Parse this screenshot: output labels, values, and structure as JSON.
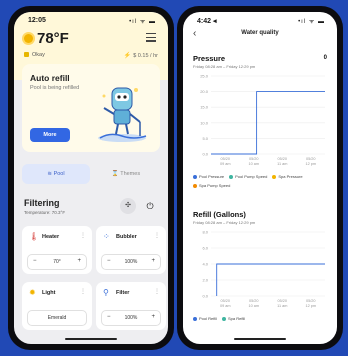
{
  "left_phone": {
    "status": {
      "time": "12:05",
      "signal": "•ıl ᯤ ▬"
    },
    "temperature": "78°F",
    "status_text": "Okay",
    "price": "$ 0.15 / hr",
    "auto_refill": {
      "title": "Auto refill",
      "text": "Pool is being refilled",
      "button": "More"
    },
    "tabs": [
      {
        "label": "Pool"
      },
      {
        "label": "Themes"
      }
    ],
    "filtering": {
      "title": "Filtering",
      "temperature": "Temperature: 70.3°F"
    },
    "controls": [
      {
        "name": "Heater",
        "value": "70°",
        "icon_color": "#d9534f"
      },
      {
        "name": "Bubbler",
        "value": "100%",
        "icon_color": "#3a6fd9"
      },
      {
        "name": "Light",
        "value": "Emerald",
        "icon_color": "#f2b400"
      },
      {
        "name": "Filter",
        "value": "100%",
        "icon_color": "#3a6fd9"
      }
    ],
    "stepper": {
      "minus": "−",
      "plus": "+"
    }
  },
  "right_phone": {
    "status": {
      "time": "4:42 ◂",
      "signal": "•ıl ᯤ ▬"
    },
    "title": "Water quality",
    "pressure": {
      "title": "Pressure",
      "range": "Friday 08:28 am – Friday 12:29 pm",
      "count": "0",
      "legend": [
        {
          "name": "Pool Pressure",
          "color": "#3a6fd9"
        },
        {
          "name": "Pool Pump Speed",
          "color": "#3fb5a0"
        },
        {
          "name": "Spa Pressure",
          "color": "#f2b400"
        },
        {
          "name": "Spa Pump Speed",
          "color": "#f28a00"
        }
      ]
    },
    "refill": {
      "title": "Refill (Gallons)",
      "range": "Friday 08:28 am – Friday 12:29 pm",
      "legend": [
        {
          "name": "Pool Refill",
          "color": "#3a6fd9"
        },
        {
          "name": "Spa Refill",
          "color": "#3fb5a0"
        }
      ]
    }
  },
  "chart_data": [
    {
      "type": "line",
      "title": "Pressure",
      "yticks": [
        "25.0",
        "20.0",
        "15.0",
        "10.0",
        "5.0",
        "0.0"
      ],
      "xticks": [
        [
          "05/20",
          "09 am"
        ],
        [
          "05/20",
          "10 am"
        ],
        [
          "05/20",
          "11 am"
        ],
        [
          "05/20",
          "12 pm"
        ]
      ],
      "ylim": [
        0,
        25
      ],
      "series": [
        {
          "name": "Pool Pressure",
          "x": [
            0.0,
            0.4,
            0.4,
            1.0
          ],
          "values": [
            0,
            0,
            20,
            20
          ]
        }
      ]
    },
    {
      "type": "line",
      "title": "Refill (Gallons)",
      "yticks": [
        "8.0",
        "6.0",
        "4.0",
        "2.0",
        "0.0"
      ],
      "xticks": [
        [
          "05/20",
          "09 am"
        ],
        [
          "05/20",
          "10 am"
        ],
        [
          "05/20",
          "11 am"
        ],
        [
          "05/20",
          "12 pm"
        ]
      ],
      "ylim": [
        0,
        8
      ],
      "series": [
        {
          "name": "Pool Refill",
          "x": [
            0.05,
            0.05,
            1.0
          ],
          "values": [
            0,
            4,
            4
          ]
        }
      ]
    }
  ]
}
